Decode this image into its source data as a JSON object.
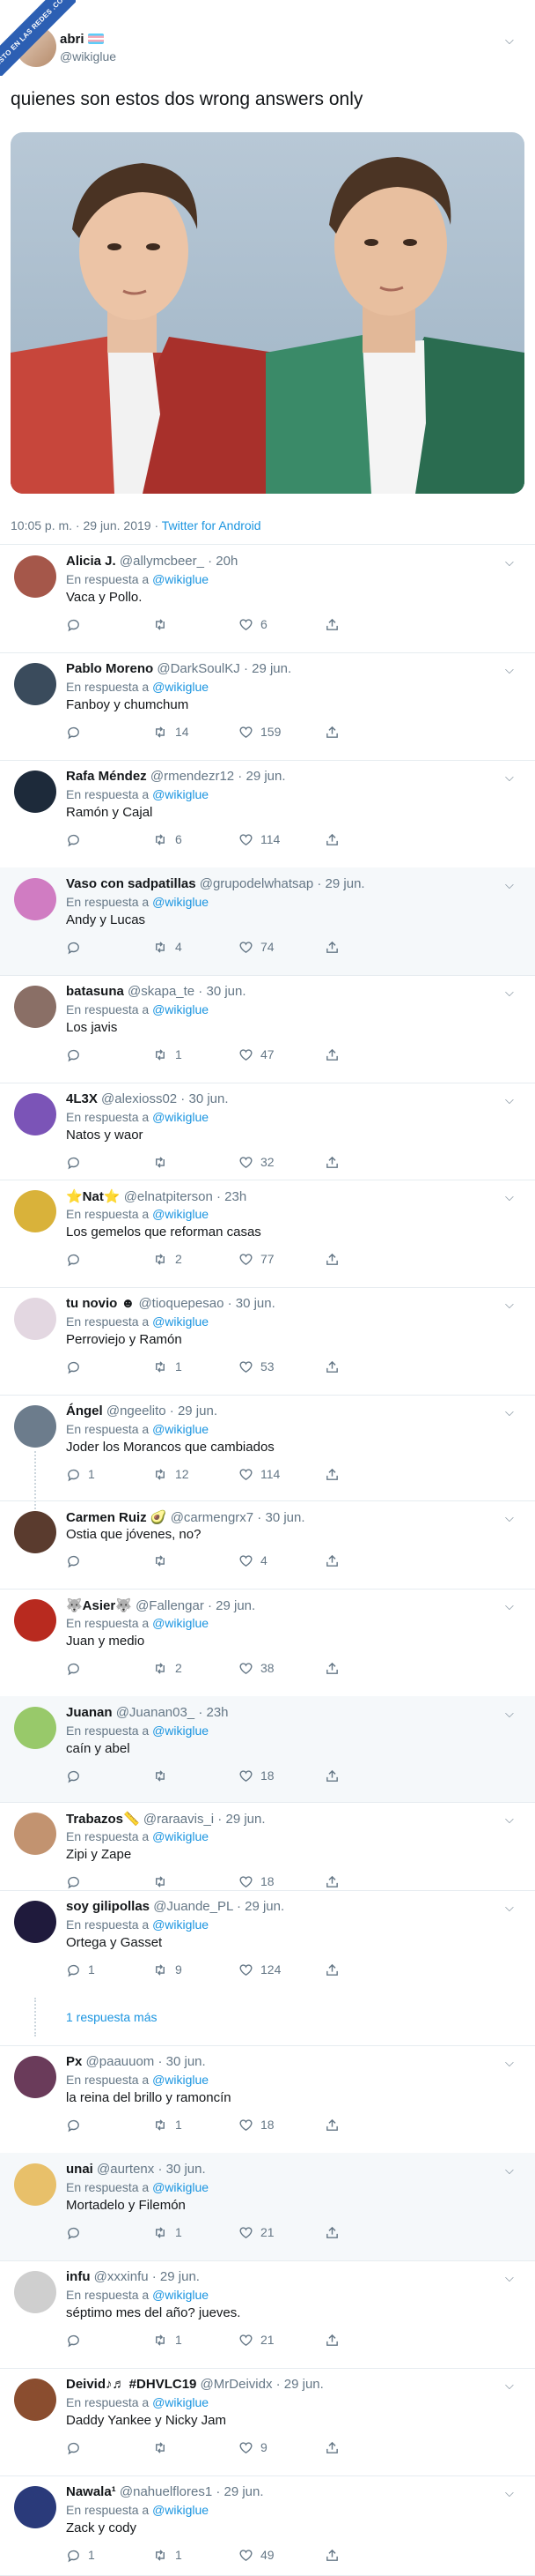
{
  "watermark": "VISTO EN LAS REDES .COM",
  "tweet": {
    "author_name": "abri",
    "author_handle": "@wikiglue",
    "text": "quienes son estos dos wrong answers only",
    "timestamp": "10:05 p. m. · 29 jun. 2019 · ",
    "source": "Twitter for Android"
  },
  "replying_prefix": "En respuesta a ",
  "replying_to": "@wikiglue",
  "show_more": "1 respuesta más",
  "colors": {
    "link": "#1b95e0",
    "secondary": "#657786",
    "divider": "#e6ecf0"
  },
  "replies": [
    {
      "name": "Alicia J.",
      "handle": "@allymcbeer_",
      "time": " · 20h",
      "text": "Vaca y Pollo.",
      "replying": true,
      "replies": "",
      "retweets": "",
      "likes": "6"
    },
    {
      "name": "Pablo Moreno",
      "handle": "@DarkSoulKJ",
      "time": " · 29 jun.",
      "text": "Fanboy y chumchum",
      "replying": true,
      "replies": "",
      "retweets": "14",
      "likes": "159"
    },
    {
      "name": "Rafa Méndez",
      "handle": "@rmendezr12",
      "time": " · 29 jun.",
      "text": "Ramón y Cajal",
      "replying": true,
      "replies": "",
      "retweets": "6",
      "likes": "114"
    },
    {
      "name": "Vaso con sadpatillas",
      "handle": "@grupodelwhatsap",
      "time": " · 29 jun.",
      "text": "Andy y Lucas",
      "replying": true,
      "replies": "",
      "retweets": "4",
      "likes": "74"
    },
    {
      "name": "batasuna",
      "handle": "@skapa_te",
      "time": " · 30 jun.",
      "text": "Los javis",
      "replying": true,
      "replies": "",
      "retweets": "1",
      "likes": "47"
    },
    {
      "name": "4L3X",
      "handle": "@alexioss02",
      "time": " · 30 jun.",
      "text": "Natos y waor",
      "replying": true,
      "replies": "",
      "retweets": "",
      "likes": "32"
    },
    {
      "name": "⭐Nat⭐",
      "handle": "@elnatpiterson",
      "time": " · 23h",
      "text": "Los gemelos que reforman casas",
      "replying": true,
      "replies": "",
      "retweets": "2",
      "likes": "77"
    },
    {
      "name": "tu novio ☻",
      "handle": "@tioquepesao",
      "time": " · 30 jun.",
      "text": "Perroviejo y Ramón",
      "replying": true,
      "replies": "",
      "retweets": "1",
      "likes": "53"
    },
    {
      "name": "Ángel",
      "handle": "@ngeelito",
      "time": " · 29 jun.",
      "text": "Joder los Morancos que cambiados",
      "replying": true,
      "replies": "1",
      "retweets": "12",
      "likes": "114"
    },
    {
      "name": "Carmen Ruiz 🥑",
      "handle": "@carmengrx7",
      "time": " · 30 jun.",
      "text": "Ostia que jóvenes, no?",
      "replying": false,
      "replies": "",
      "retweets": "",
      "likes": "4"
    },
    {
      "name": "🐺Asier🐺",
      "handle": "@Fallengar",
      "time": " · 29 jun.",
      "text": "Juan y medio",
      "replying": true,
      "replies": "",
      "retweets": "2",
      "likes": "38"
    },
    {
      "name": "Juanan",
      "handle": "@Juanan03_",
      "time": " · 23h",
      "text": "caín y abel",
      "replying": true,
      "replies": "",
      "retweets": "",
      "likes": "18"
    },
    {
      "name": "Trabazos📏",
      "handle": "@raraavis_i",
      "time": " · 29 jun.",
      "text": "Zipi y Zape",
      "replying": true,
      "replies": "",
      "retweets": "",
      "likes": "18"
    },
    {
      "name": "soy gilipollas",
      "handle": "@Juande_PL",
      "time": " · 29 jun.",
      "text": "Ortega y Gasset",
      "replying": true,
      "replies": "1",
      "retweets": "9",
      "likes": "124"
    },
    {
      "name": "Px",
      "handle": "@paauuom",
      "time": " · 30 jun.",
      "text": "la reina del brillo y ramoncín",
      "replying": true,
      "replies": "",
      "retweets": "1",
      "likes": "18"
    },
    {
      "name": "unai",
      "handle": "@aurtenx",
      "time": " · 30 jun.",
      "text": "Mortadelo y Filemón",
      "replying": true,
      "replies": "",
      "retweets": "1",
      "likes": "21"
    },
    {
      "name": "infu",
      "handle": "@xxxinfu",
      "time": " · 29 jun.",
      "text": "séptimo mes del año? jueves.",
      "replying": true,
      "replies": "",
      "retweets": "1",
      "likes": "21"
    },
    {
      "name": "Deivid♪♬ #DHVLC19",
      "handle": "@MrDeividx",
      "time": " · 29 jun.",
      "text": "Daddy Yankee y Nicky Jam",
      "replying": true,
      "replies": "",
      "retweets": "",
      "likes": "9"
    },
    {
      "name": "Nawala¹",
      "handle": "@nahuelflores1",
      "time": " · 29 jun.",
      "text": "Zack y cody",
      "replying": true,
      "replies": "1",
      "retweets": "1",
      "likes": "49"
    }
  ]
}
